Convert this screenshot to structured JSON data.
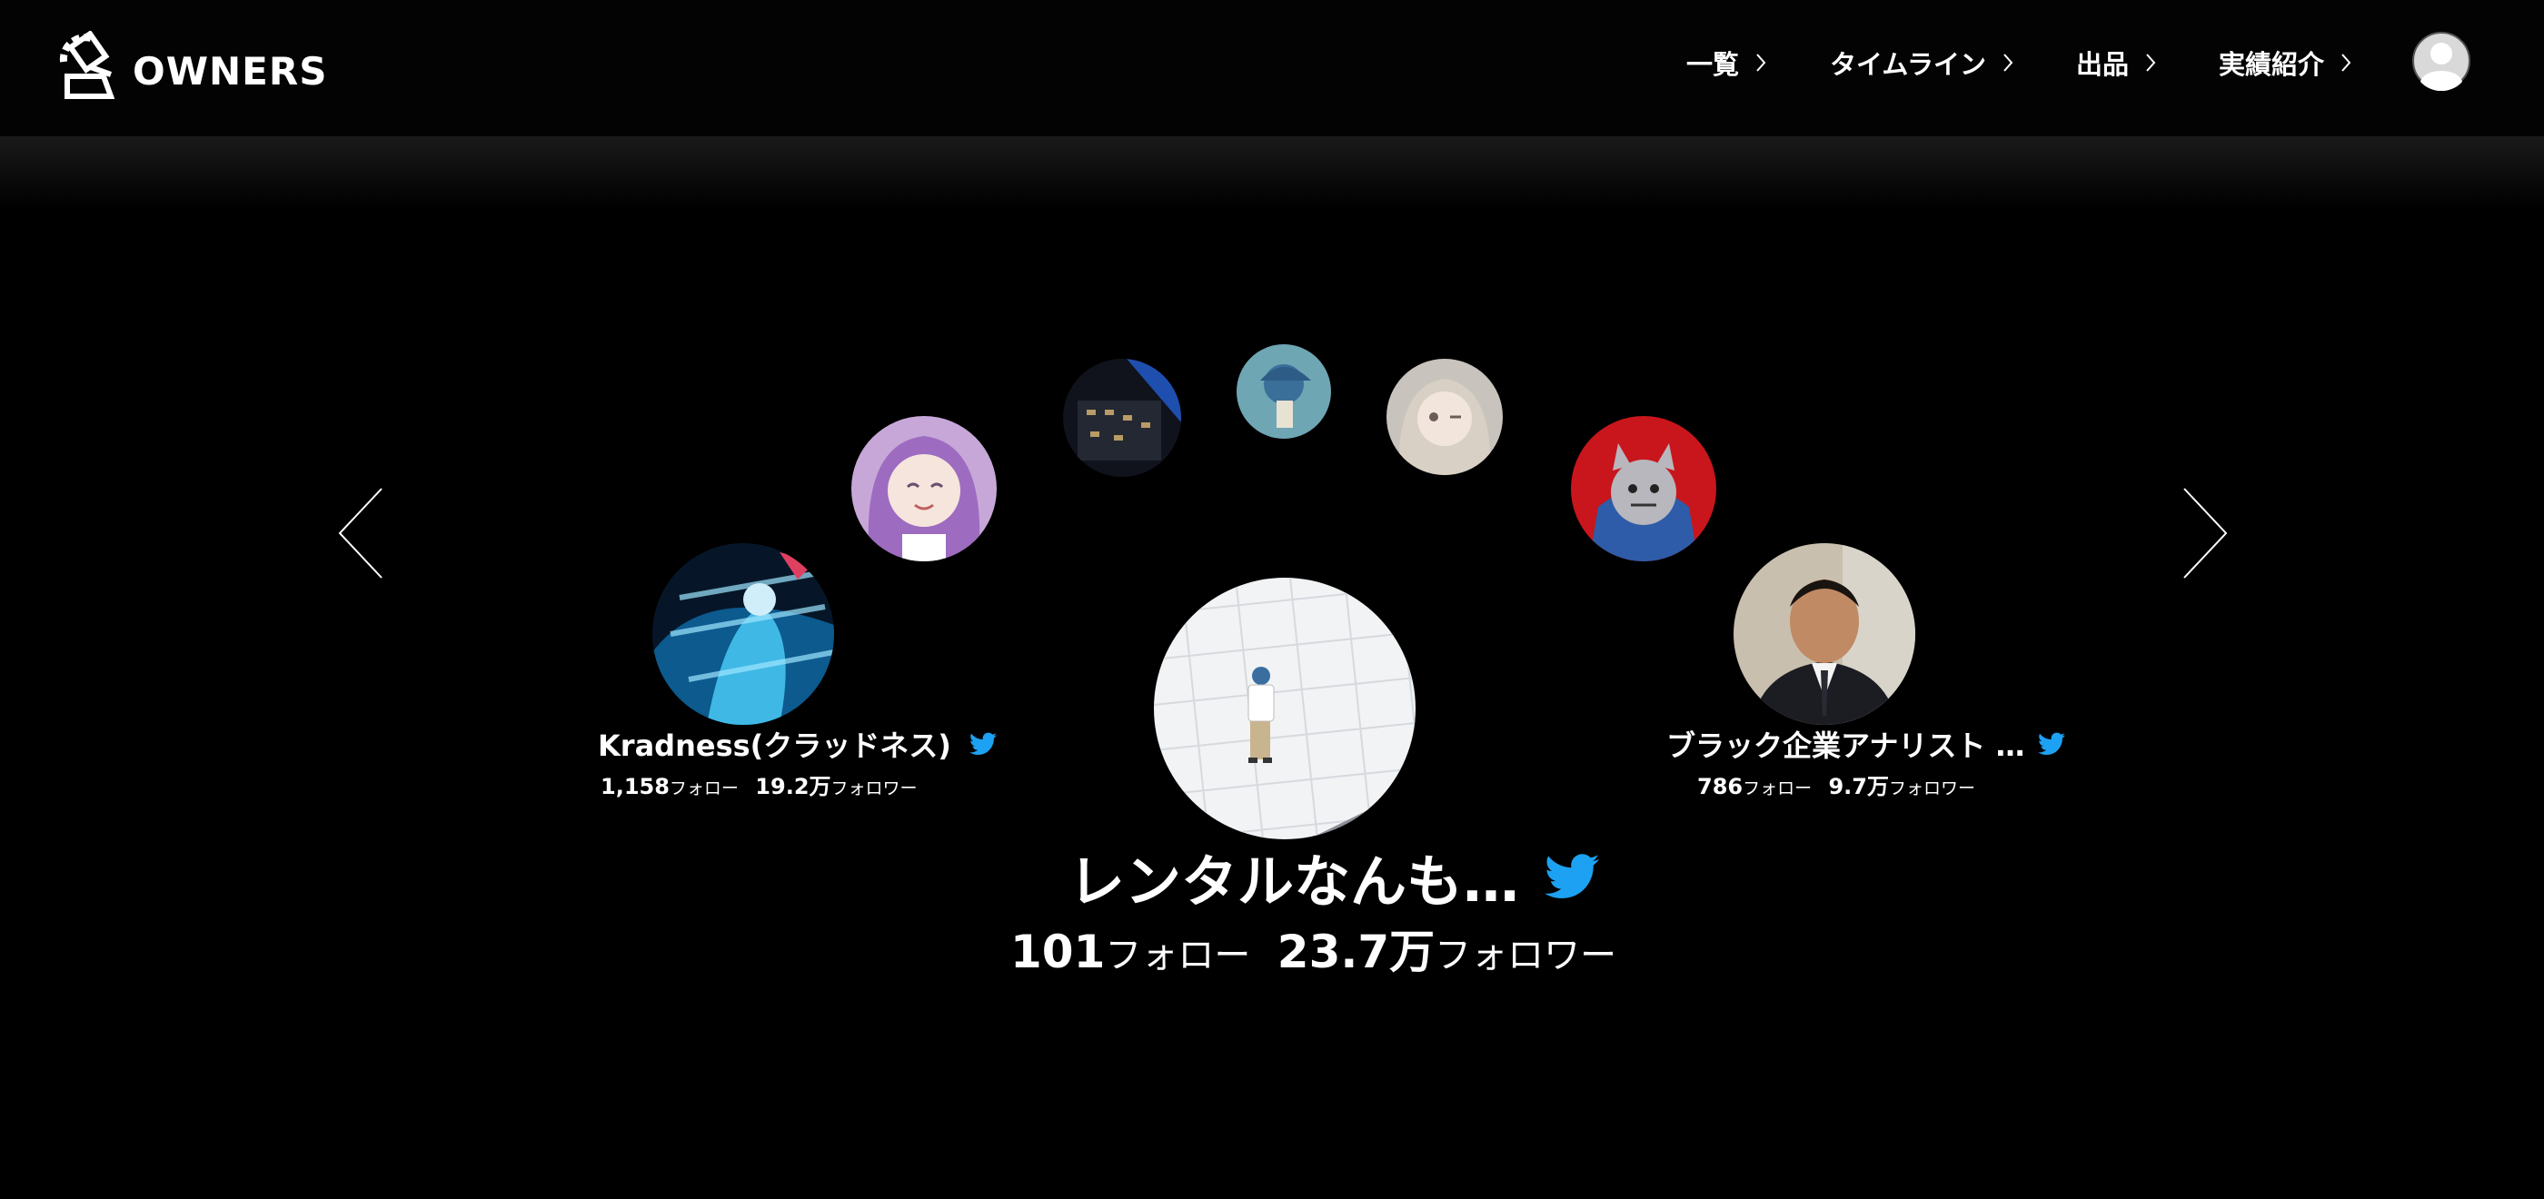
{
  "app": {
    "logo_text": "OWNERS"
  },
  "nav": {
    "items": [
      {
        "label": "一覧"
      },
      {
        "label": "タイムライン"
      },
      {
        "label": "出品"
      },
      {
        "label": "実績紹介"
      }
    ]
  },
  "colors": {
    "twitter": "#1da1f2",
    "background": "#000000"
  },
  "carousel": {
    "center": {
      "name": "レンタルなんも…",
      "follow_count": "101",
      "follow_unit": "フォロー",
      "follower_count": "23.7万",
      "follower_unit": "フォロワー"
    },
    "left": {
      "name": "Kradness(クラッドネス)",
      "follow_count": "1,158",
      "follow_unit": "フォロー",
      "follower_count": "19.2万",
      "follower_unit": "フォロワー"
    },
    "right": {
      "name": "ブラック企業アナリスト …",
      "follow_count": "786",
      "follow_unit": "フォロー",
      "follower_count": "9.7万",
      "follower_unit": "フォロワー"
    }
  }
}
